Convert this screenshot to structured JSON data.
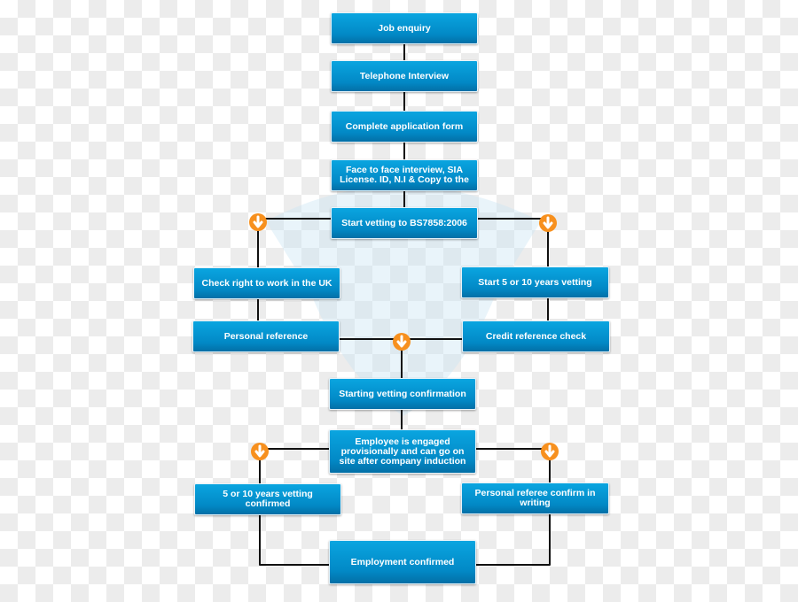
{
  "colors": {
    "box": "#0a9ad6",
    "connector": "#111111",
    "arrow_badge": "#f7901e"
  },
  "nodes": [
    {
      "id": "job-enquiry",
      "label": "Job enquiry"
    },
    {
      "id": "telephone-interview",
      "label": "Telephone Interview"
    },
    {
      "id": "complete-application-form",
      "label": "Complete application form"
    },
    {
      "id": "face-to-face-interview",
      "label": "Face to face interview, SIA License. ID, N.I & Copy to the"
    },
    {
      "id": "start-vetting",
      "label": "Start vetting to BS7858:2006"
    },
    {
      "id": "check-right-to-work",
      "label": "Check right to work in the UK"
    },
    {
      "id": "start-5-or-10-years-vetting",
      "label": "Start 5 or 10 years vetting"
    },
    {
      "id": "personal-reference",
      "label": "Personal reference"
    },
    {
      "id": "credit-reference-check",
      "label": "Credit reference check"
    },
    {
      "id": "starting-vetting-confirmation",
      "label": "Starting vetting confirmation"
    },
    {
      "id": "employee-engaged-provisionally",
      "label": "Employee is engaged provisionally and can go on site after company induction"
    },
    {
      "id": "vetting-confirmed",
      "label": "5 or 10 years vetting confirmed"
    },
    {
      "id": "personal-referee-confirm",
      "label": "Personal referee confirm in writing"
    },
    {
      "id": "employment-confirmed",
      "label": "Employment confirmed"
    }
  ],
  "edges": [
    [
      "job-enquiry",
      "telephone-interview"
    ],
    [
      "telephone-interview",
      "complete-application-form"
    ],
    [
      "complete-application-form",
      "face-to-face-interview"
    ],
    [
      "face-to-face-interview",
      "start-vetting"
    ],
    [
      "start-vetting",
      "check-right-to-work"
    ],
    [
      "start-vetting",
      "start-5-or-10-years-vetting"
    ],
    [
      "check-right-to-work",
      "personal-reference"
    ],
    [
      "start-5-or-10-years-vetting",
      "credit-reference-check"
    ],
    [
      "personal-reference",
      "starting-vetting-confirmation"
    ],
    [
      "credit-reference-check",
      "starting-vetting-confirmation"
    ],
    [
      "starting-vetting-confirmation",
      "employee-engaged-provisionally"
    ],
    [
      "employee-engaged-provisionally",
      "vetting-confirmed"
    ],
    [
      "employee-engaged-provisionally",
      "personal-referee-confirm"
    ],
    [
      "vetting-confirmed",
      "employment-confirmed"
    ],
    [
      "personal-referee-confirm",
      "employment-confirmed"
    ]
  ]
}
